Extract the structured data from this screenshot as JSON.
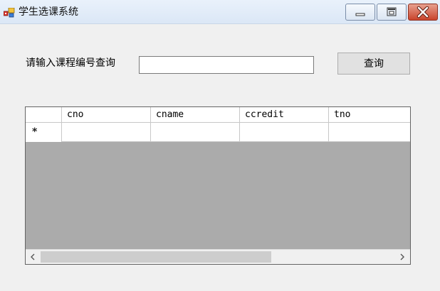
{
  "window": {
    "title": "学生选课系统",
    "controls": {
      "minimize_icon": "minimize-icon",
      "maximize_icon": "maximize-icon",
      "close_icon": "close-icon"
    }
  },
  "query": {
    "label": "请输入课程编号查询",
    "input_value": "",
    "button_label": "查询"
  },
  "grid": {
    "columns": [
      "cno",
      "cname",
      "ccredit",
      "tno"
    ],
    "new_row_marker": "*",
    "rows": [
      [
        "",
        "",
        "",
        ""
      ]
    ]
  },
  "colors": {
    "title_bar": "#dbe7f6",
    "close_button": "#c9442c",
    "grid_background": "#ababab",
    "window_background": "#f0f0f0"
  }
}
